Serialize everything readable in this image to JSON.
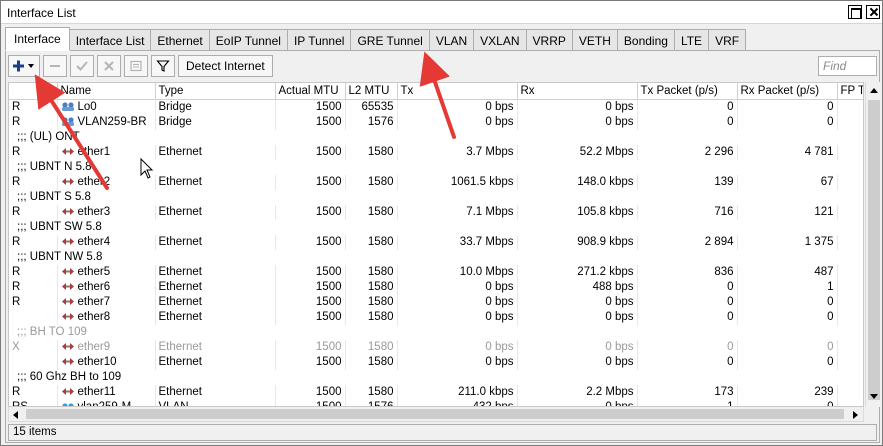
{
  "window": {
    "title": "Interface List"
  },
  "tabs": [
    "Interface",
    "Interface List",
    "Ethernet",
    "EoIP Tunnel",
    "IP Tunnel",
    "GRE Tunnel",
    "VLAN",
    "VXLAN",
    "VRRP",
    "VETH",
    "Bonding",
    "LTE",
    "VRF"
  ],
  "active_tab": "Interface",
  "toolbar": {
    "add_icon": "plus-icon",
    "remove_icon": "minus-icon",
    "enable_icon": "check-icon",
    "disable_icon": "x-icon",
    "comment_icon": "comment-icon",
    "filter_icon": "filter-icon",
    "detect_label": "Detect Internet",
    "find_placeholder": "Find"
  },
  "columns": [
    "",
    "Name",
    "Type",
    "Actual MTU",
    "L2 MTU",
    "Tx",
    "Rx",
    "Tx Packet (p/s)",
    "Rx Packet (p/s)",
    "FP Tx"
  ],
  "rows": [
    {
      "kind": "row",
      "flag": "R",
      "icon": "bridge",
      "name": "Lo0",
      "type": "Bridge",
      "mtu": "1500",
      "l2": "65535",
      "tx": "0 bps",
      "rx": "0 bps",
      "txp": "0",
      "rxp": "0"
    },
    {
      "kind": "row",
      "flag": "R",
      "icon": "bridge",
      "name": "VLAN259-BR",
      "type": "Bridge",
      "mtu": "1500",
      "l2": "1576",
      "tx": "0 bps",
      "rx": "0 bps",
      "txp": "0",
      "rxp": "0"
    },
    {
      "kind": "comment",
      "text": ";;; (UL) ONT"
    },
    {
      "kind": "row",
      "flag": "R",
      "icon": "ether",
      "name": "ether1",
      "type": "Ethernet",
      "mtu": "1500",
      "l2": "1580",
      "tx": "3.7 Mbps",
      "rx": "52.2 Mbps",
      "txp": "2 296",
      "rxp": "4 781"
    },
    {
      "kind": "comment",
      "text": ";;; UBNT N 5.8"
    },
    {
      "kind": "row",
      "flag": "R",
      "icon": "ether",
      "name": "ether2",
      "type": "Ethernet",
      "mtu": "1500",
      "l2": "1580",
      "tx": "1061.5 kbps",
      "rx": "148.0 kbps",
      "txp": "139",
      "rxp": "67"
    },
    {
      "kind": "comment",
      "text": ";;; UBNT S 5.8"
    },
    {
      "kind": "row",
      "flag": "R",
      "icon": "ether",
      "name": "ether3",
      "type": "Ethernet",
      "mtu": "1500",
      "l2": "1580",
      "tx": "7.1 Mbps",
      "rx": "105.8 kbps",
      "txp": "716",
      "rxp": "121"
    },
    {
      "kind": "comment",
      "text": ";;; UBNT SW 5.8"
    },
    {
      "kind": "row",
      "flag": "R",
      "icon": "ether",
      "name": "ether4",
      "type": "Ethernet",
      "mtu": "1500",
      "l2": "1580",
      "tx": "33.7 Mbps",
      "rx": "908.9 kbps",
      "txp": "2 894",
      "rxp": "1 375"
    },
    {
      "kind": "comment",
      "text": ";;; UBNT NW 5.8"
    },
    {
      "kind": "row",
      "flag": "R",
      "icon": "ether",
      "name": "ether5",
      "type": "Ethernet",
      "mtu": "1500",
      "l2": "1580",
      "tx": "10.0 Mbps",
      "rx": "271.2 kbps",
      "txp": "836",
      "rxp": "487"
    },
    {
      "kind": "row",
      "flag": "R",
      "icon": "ether",
      "name": "ether6",
      "type": "Ethernet",
      "mtu": "1500",
      "l2": "1580",
      "tx": "0 bps",
      "rx": "488 bps",
      "txp": "0",
      "rxp": "1"
    },
    {
      "kind": "row",
      "flag": "R",
      "icon": "ether",
      "name": "ether7",
      "type": "Ethernet",
      "mtu": "1500",
      "l2": "1580",
      "tx": "0 bps",
      "rx": "0 bps",
      "txp": "0",
      "rxp": "0"
    },
    {
      "kind": "row",
      "flag": "",
      "icon": "ether",
      "name": "ether8",
      "type": "Ethernet",
      "mtu": "1500",
      "l2": "1580",
      "tx": "0 bps",
      "rx": "0 bps",
      "txp": "0",
      "rxp": "0"
    },
    {
      "kind": "comment",
      "disabled": true,
      "text": ";;; BH TO 109"
    },
    {
      "kind": "row",
      "disabled": true,
      "flag": "X",
      "icon": "ether",
      "name": "ether9",
      "type": "Ethernet",
      "mtu": "1500",
      "l2": "1580",
      "tx": "0 bps",
      "rx": "0 bps",
      "txp": "0",
      "rxp": "0"
    },
    {
      "kind": "row",
      "flag": "",
      "icon": "ether",
      "name": "ether10",
      "type": "Ethernet",
      "mtu": "1500",
      "l2": "1580",
      "tx": "0 bps",
      "rx": "0 bps",
      "txp": "0",
      "rxp": "0"
    },
    {
      "kind": "comment",
      "text": ";;; 60 Ghz BH to 109"
    },
    {
      "kind": "row",
      "flag": "R",
      "icon": "ether",
      "name": "ether11",
      "type": "Ethernet",
      "mtu": "1500",
      "l2": "1580",
      "tx": "211.0 kbps",
      "rx": "2.2 Mbps",
      "txp": "173",
      "rxp": "239"
    },
    {
      "kind": "row",
      "flag": "RS",
      "icon": "vlan",
      "name": "vlan259-M...",
      "type": "VLAN",
      "mtu": "1500",
      "l2": "1576",
      "tx": "432 bps",
      "rx": "0 bps",
      "txp": "1",
      "rxp": "0"
    }
  ],
  "status": {
    "items": "15 items"
  },
  "colors": {
    "annotation_arrow": "#e53935",
    "tab_border": "#adadad"
  }
}
